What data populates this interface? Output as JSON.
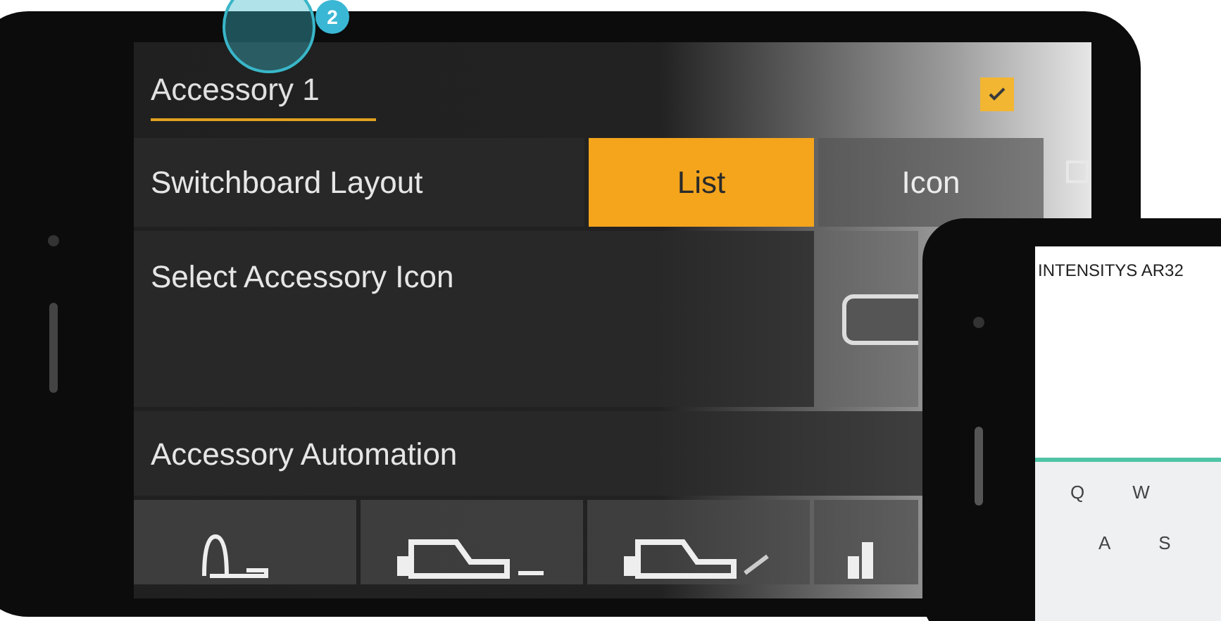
{
  "accessory": {
    "name_field": {
      "value": "Accessory 1"
    },
    "enabled": {
      "checked": true
    }
  },
  "callout": {
    "badge": "2"
  },
  "layout_setting": {
    "label": "Switchboard Layout",
    "options": [
      {
        "label": "List",
        "selected": true
      },
      {
        "label": "Icon",
        "selected": false
      }
    ],
    "side_checkbox": {
      "checked": false
    }
  },
  "icon_setting": {
    "label": "Select Accessory Icon"
  },
  "automation": {
    "label": "Accessory Automation",
    "options": [
      {
        "kind": "light"
      },
      {
        "kind": "vehicle"
      },
      {
        "kind": "vehicle-wiper"
      },
      {
        "kind": "bars"
      }
    ]
  },
  "second_phone": {
    "header": "INTENSITYS AR32",
    "keyboard": [
      [
        "Q",
        "W"
      ],
      [
        "A",
        "S"
      ]
    ]
  }
}
